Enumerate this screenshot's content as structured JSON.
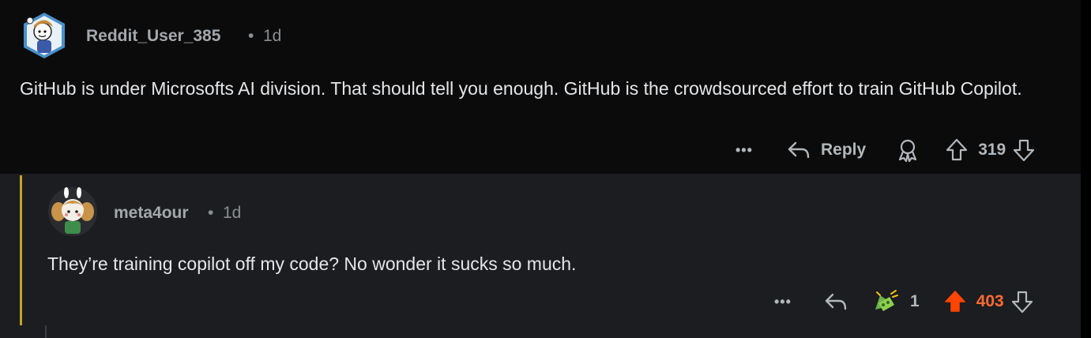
{
  "parent_comment": {
    "author": "Reddit_User_385",
    "separator": "•",
    "age": "1d",
    "body": "GitHub is under Microsofts AI division. That should tell you enough. GitHub is the crowdsourced effort to train GitHub Copilot.",
    "actions": {
      "more": "•••",
      "reply_label": "Reply",
      "score": "319"
    }
  },
  "reply_comment": {
    "author": "meta4our",
    "separator": "•",
    "age": "1d",
    "body": "They’re training copilot off my code? No wonder it sucks so much.",
    "actions": {
      "more": "•••",
      "award_count": "1",
      "score": "403"
    }
  },
  "colors": {
    "upvoted": "#ff4500",
    "thread_line": "#c9a227",
    "background_top": "#0b0b0c",
    "background_reply": "#1b1d20"
  }
}
